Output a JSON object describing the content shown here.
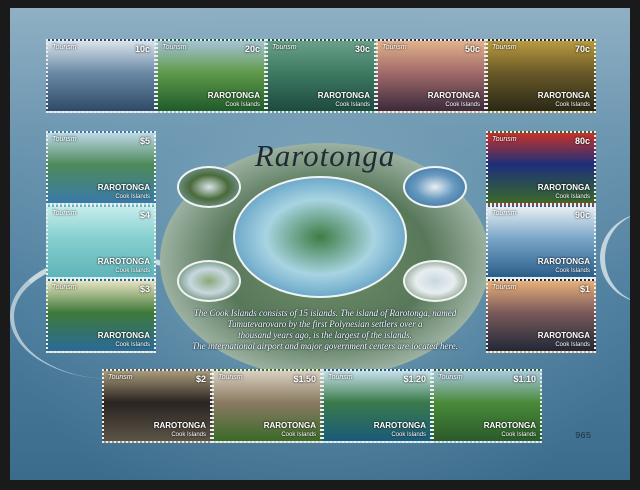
{
  "sheet": {
    "title": "Rarotonga",
    "description_lines": [
      "The Cook Islands consists of 15 islands. The island of Rarotonga, named",
      "Tumutevarovaro by the first Polynesian settlers over a",
      "thousand years ago, is the largest of the islands.",
      "The international airport and major government centers are located here."
    ],
    "serial_number": "965",
    "stamp_tag": "Tourism",
    "stamp_name": "RAROTONGA",
    "stamp_country": "Cook Islands"
  },
  "stamps": [
    {
      "value": "10c",
      "scene": "whale-sea",
      "colors": [
        "#2e4a66",
        "#6b8aa6",
        "#d9e2ea"
      ]
    },
    {
      "value": "20c",
      "scene": "palm-trees",
      "colors": [
        "#1f5a2a",
        "#5f9a4a",
        "#a6c3d6"
      ]
    },
    {
      "value": "30c",
      "scene": "starfish",
      "colors": [
        "#1e4a40",
        "#3e7a62",
        "#6aa08a"
      ]
    },
    {
      "value": "50c",
      "scene": "sunset-beach",
      "colors": [
        "#3a2a3c",
        "#a26a6a",
        "#e2b28a"
      ]
    },
    {
      "value": "70c",
      "scene": "crab",
      "colors": [
        "#2a2818",
        "#6a5a28",
        "#b89a40"
      ]
    },
    {
      "value": "$5",
      "scene": "atoll-aerial",
      "colors": [
        "#3a7aa8",
        "#4e8a5a",
        "#bcd8e6"
      ]
    },
    {
      "value": "$4",
      "scene": "lagoon-fish",
      "colors": [
        "#5eb4b8",
        "#86cfcf",
        "#c6ecec"
      ]
    },
    {
      "value": "$3",
      "scene": "islet-beach",
      "colors": [
        "#2a6a9a",
        "#3f7a3a",
        "#e8e2c0"
      ]
    },
    {
      "value": "80c",
      "scene": "flag",
      "colors": [
        "#3a6a2a",
        "#1c2f7a",
        "#c8322a"
      ]
    },
    {
      "value": "90c",
      "scene": "windsurf",
      "colors": [
        "#2a5e8a",
        "#7aa6c8",
        "#e6eef2"
      ]
    },
    {
      "value": "$1",
      "scene": "evening-shore",
      "colors": [
        "#202838",
        "#7a5a5a",
        "#e8b07a"
      ]
    },
    {
      "value": "$2",
      "scene": "rooster",
      "colors": [
        "#5a5448",
        "#2a2420",
        "#a89a7a"
      ]
    },
    {
      "value": "$1.50",
      "scene": "goat",
      "colors": [
        "#3a6a28",
        "#8a7a62",
        "#d8d0c0"
      ]
    },
    {
      "value": "$1.20",
      "scene": "palm-beach",
      "colors": [
        "#1a5a7a",
        "#3a7a4a",
        "#c6e0ea"
      ]
    },
    {
      "value": "$1.10",
      "scene": "green-peaks",
      "colors": [
        "#2a5a2a",
        "#4a8a3a",
        "#a8c8e0"
      ]
    }
  ],
  "vignettes": [
    {
      "name": "airplane-landing",
      "colors": [
        "#8ab0c8",
        "#d8e4ea",
        "#4a6a3a"
      ]
    },
    {
      "name": "cruise-ship",
      "colors": [
        "#2a6a9a",
        "#e8eef2",
        "#6a9ac0"
      ]
    },
    {
      "name": "island-aerial",
      "colors": [
        "#2f7bb0",
        "#3e7d44",
        "#a8d4e2"
      ]
    },
    {
      "name": "road-palms",
      "colors": [
        "#3a6a3a",
        "#8aa87a",
        "#c8d8e0"
      ]
    },
    {
      "name": "airplane-tail",
      "colors": [
        "#5a7a5a",
        "#c8d8e0",
        "#e8eef0"
      ]
    }
  ]
}
